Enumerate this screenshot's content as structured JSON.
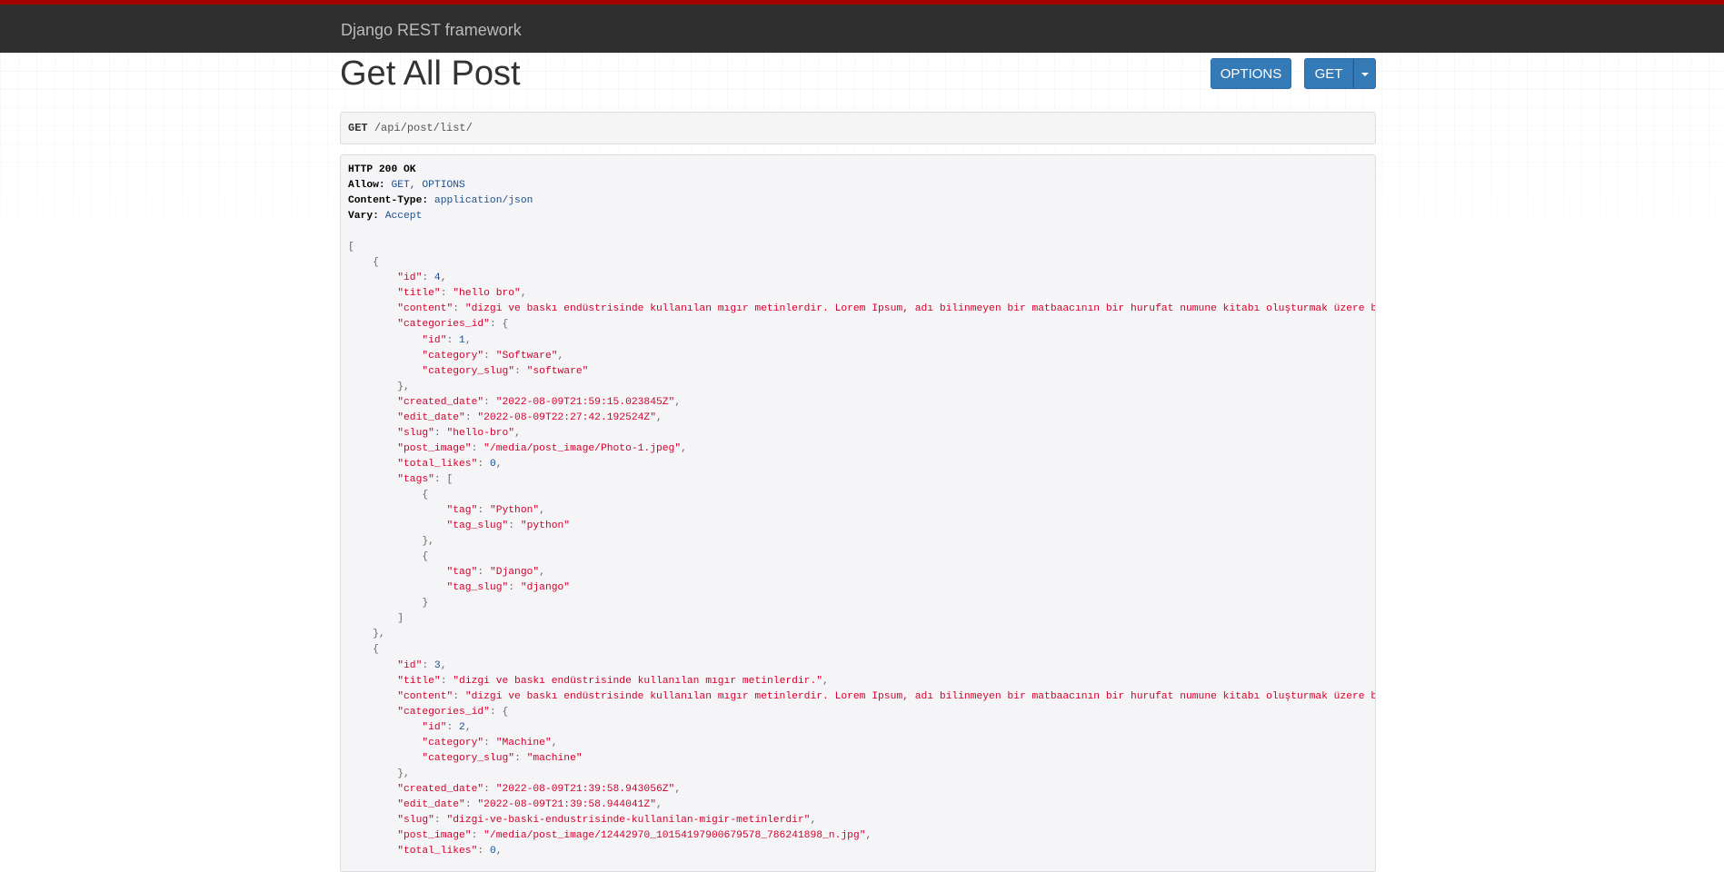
{
  "navbar": {
    "brand": "Django REST framework",
    "accent": "#a30000"
  },
  "page": {
    "title": "Get All Post"
  },
  "buttons": {
    "options": "OPTIONS",
    "get": "GET",
    "caret_icon": "caret-down-icon"
  },
  "request": {
    "method": "GET",
    "path": "/api/post/list/"
  },
  "response": {
    "status": "HTTP 200 OK",
    "headers": [
      {
        "key": "Allow",
        "value": "GET, OPTIONS"
      },
      {
        "key": "Content-Type",
        "value": "application/json"
      },
      {
        "key": "Vary",
        "value": "Accept"
      }
    ],
    "posts": [
      {
        "id": "4",
        "title": "\"hello bro\"",
        "content": "\"dizgi ve baskı endüstrisinde kullanılan mıgır metinlerdir. Lorem Ipsum, adı bilinmeyen bir matbaacının bir hurufat numune kitabı oluşturmak üzere bir yazı galerisini alarak karıştırdığı 1500'lerden beri endüstri standardı sahte metinler olarak kullanılmıştır.\"",
        "categories_id": {
          "id": "1",
          "category": "\"Software\"",
          "category_slug": "\"software\""
        },
        "created_date": "\"2022-08-09T21:59:15.023845Z\"",
        "edit_date": "\"2022-08-09T22:27:42.192524Z\"",
        "slug": "\"hello-bro\"",
        "post_image": "\"/media/post_image/Photo-1.jpeg\"",
        "total_likes": "0",
        "tags": [
          {
            "tag": "\"Python\"",
            "tag_slug": "\"python\""
          },
          {
            "tag": "\"Django\"",
            "tag_slug": "\"django\""
          }
        ]
      },
      {
        "id": "3",
        "title": "\"dizgi ve baskı endüstrisinde kullanılan mıgır metinlerdir.\"",
        "content": "\"dizgi ve baskı endüstrisinde kullanılan mıgır metinlerdir. Lorem Ipsum, adı bilinmeyen bir matbaacının bir hurufat numune kitabı oluşturmak üzere bir yazı galerisini alarak karıştırdığı 1500'lerden beri endüstri standardı sahte metinler olarak kullanılmıştır.\"",
        "categories_id": {
          "id": "2",
          "category": "\"Machine\"",
          "category_slug": "\"machine\""
        },
        "created_date": "\"2022-08-09T21:39:58.943056Z\"",
        "edit_date": "\"2022-08-09T21:39:58.944041Z\"",
        "slug": "\"dizgi-ve-baski-endustrisinde-kullanilan-migir-metinlerdir\"",
        "post_image": "\"/media/post_image/12442970_10154197900679578_786241898_n.jpg\"",
        "total_likes": "0"
      }
    ]
  }
}
